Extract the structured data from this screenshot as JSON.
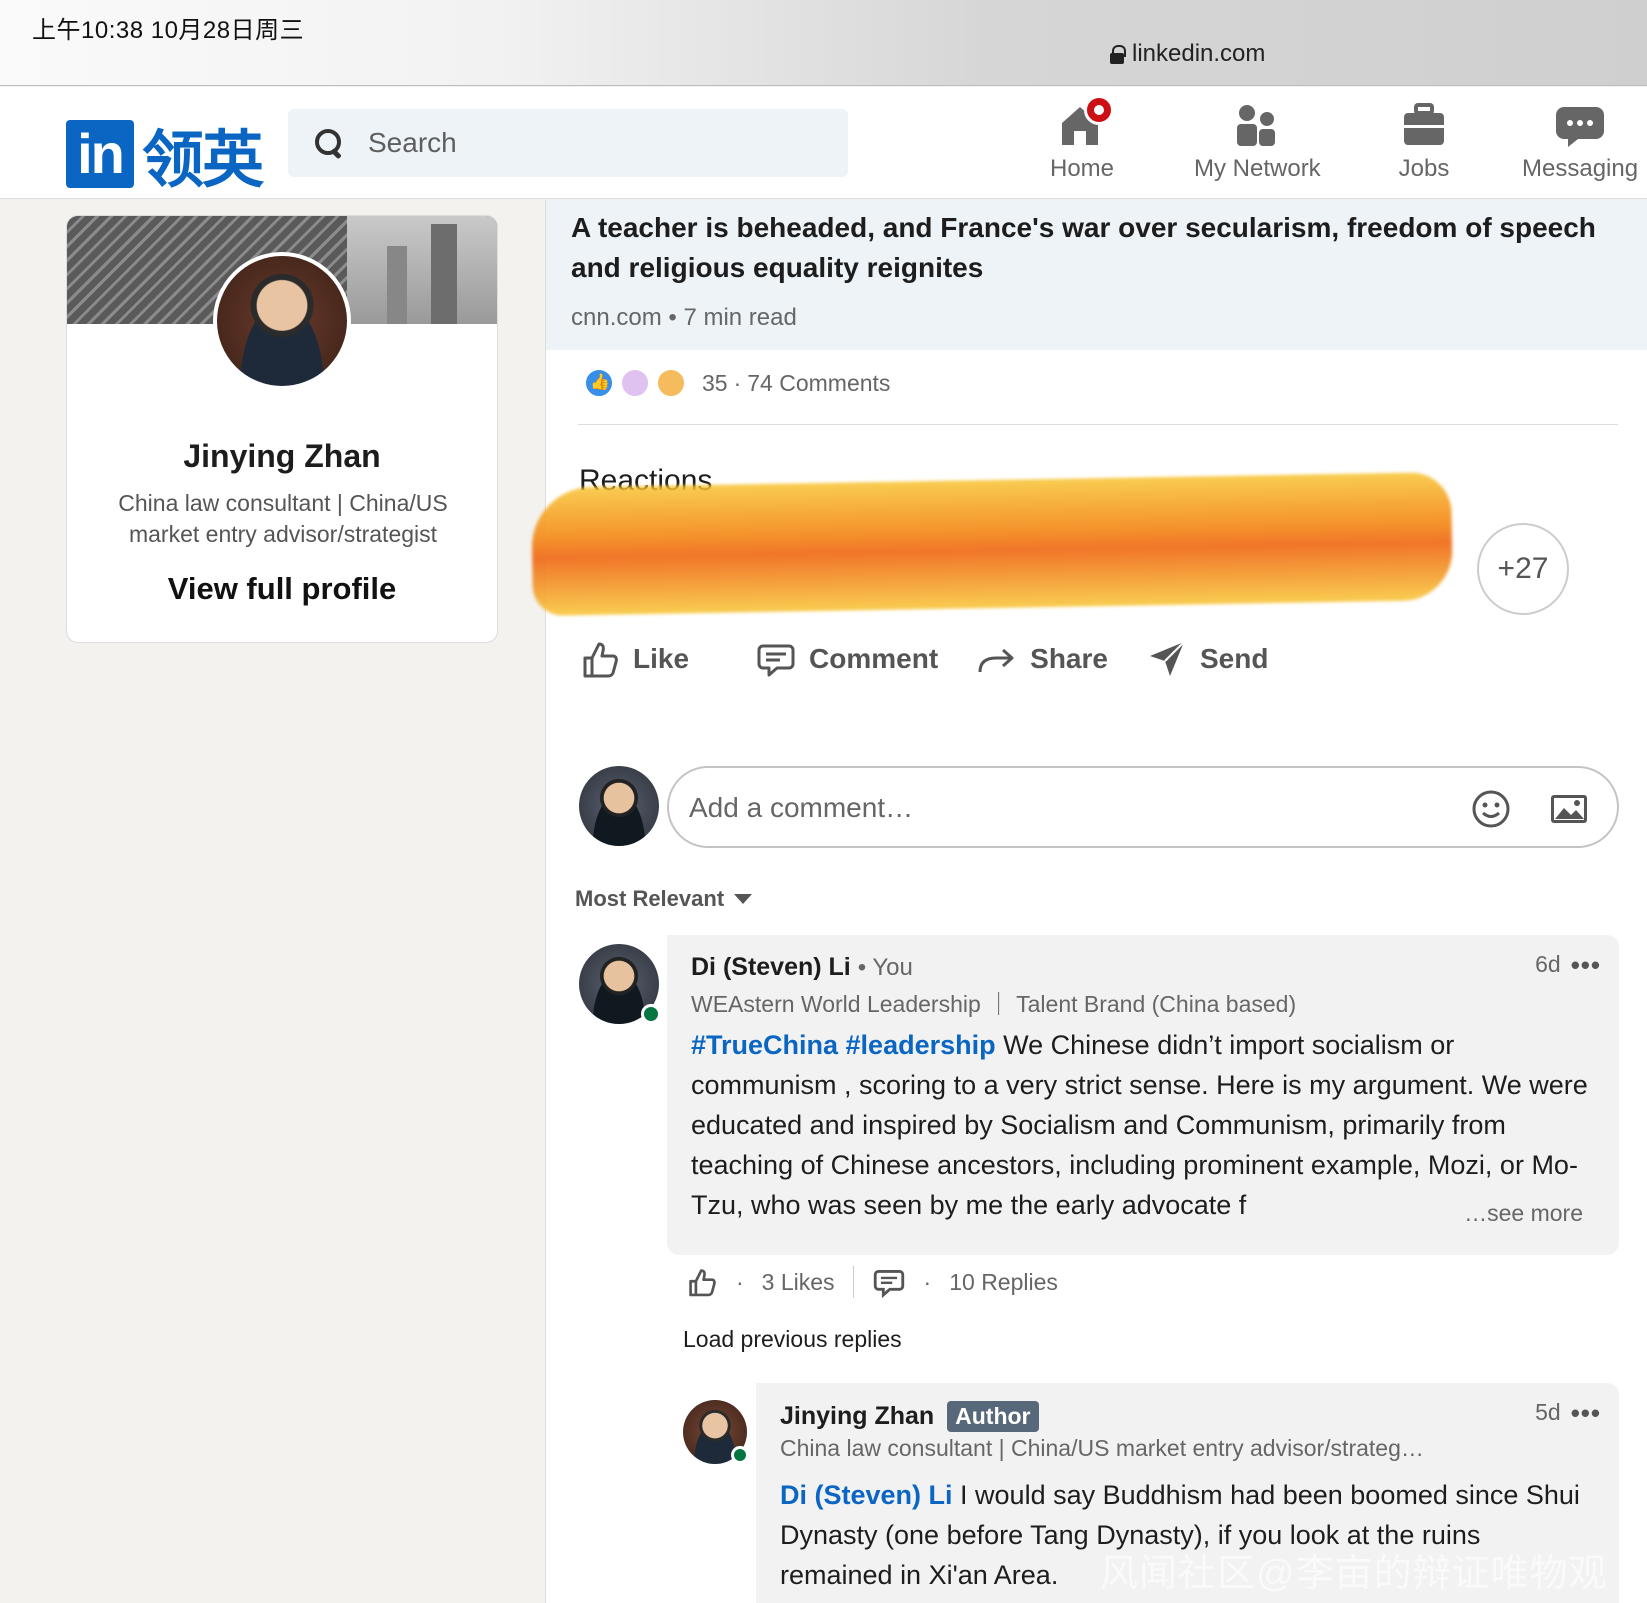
{
  "status_bar": {
    "time": "上午10:38   10月28日周三",
    "url": "linkedin.com"
  },
  "nav": {
    "logo_in": "in",
    "logo_cn": "领英",
    "search_placeholder": "Search",
    "items": [
      {
        "label": "Home",
        "icon": "home-icon"
      },
      {
        "label": "My Network",
        "icon": "network-icon"
      },
      {
        "label": "Jobs",
        "icon": "briefcase-icon"
      },
      {
        "label": "Messaging",
        "icon": "messaging-icon"
      }
    ]
  },
  "profile": {
    "name": "Jinying Zhan",
    "headline": "China law consultant | China/US market entry advisor/strategist",
    "link": "View full profile"
  },
  "article": {
    "title": "A teacher is beheaded, and France's war over secularism, freedom of speech and religious equality reignites",
    "source": "cnn.com",
    "read_time": "7 min read"
  },
  "social_counts": {
    "reactions": "35",
    "comments": "74 Comments",
    "reaction_icons": [
      "like-icon",
      "curious-icon",
      "insightful-icon"
    ]
  },
  "reactions": {
    "title": "Reactions",
    "more": "+27"
  },
  "actions": {
    "like": "Like",
    "comment": "Comment",
    "share": "Share",
    "send": "Send"
  },
  "comment_box": {
    "placeholder": "Add a comment…"
  },
  "sort": {
    "label": "Most Relevant"
  },
  "comments": [
    {
      "name": "Di (Steven) Li",
      "relation": "You",
      "subtitle": "WEAstern World Leadership ｜ Talent Brand (China based)",
      "time": "6d",
      "tags": "#TrueChina #leadership",
      "text": " We Chinese didn’t import socialism or communism , scoring to a very strict sense. Here is my argument. We were educated and inspired by Socialism and Communism, primarily from teaching of Chinese ancestors, including prominent example, Mozi, or Mo-Tzu, who was seen by me the early advocate f",
      "see_more": "…see more",
      "likes": "3 Likes",
      "replies": "10 Replies"
    },
    {
      "load_previous": "Load previous replies",
      "name": "Jinying Zhan",
      "badge": "Author",
      "subtitle": "China law consultant | China/US market entry advisor/strateg…",
      "time": "5d",
      "mention": "Di (Steven) Li",
      "text": " I would say Buddhism had been boomed since Shui Dynasty (one before Tang Dynasty), if you look at the ruins remained in Xi'an Area."
    }
  ],
  "watermark": "风闻社区@李亩的辩证唯物观",
  "colors": {
    "brand": "#0a66c2",
    "online": "#057642",
    "notification": "#cc1016"
  }
}
